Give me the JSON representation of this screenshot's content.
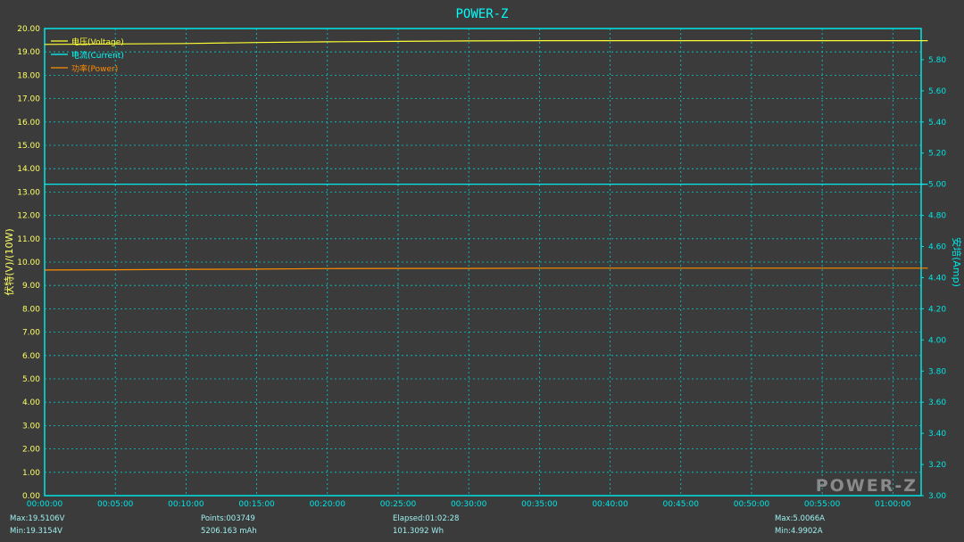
{
  "app_title": "POWER-Z",
  "watermark": "POWER-Z",
  "colors": {
    "background": "#3b3b3b",
    "plot_border": "#00e5e5",
    "grid": "#00d0d0",
    "title": "#00ffff",
    "left_axis_text": "#ffff66",
    "right_axis_text": "#00e5e5",
    "voltage": "#ffff33",
    "current": "#00ffff",
    "power": "#ff8c00",
    "watermark": "#8a8a8a"
  },
  "chart_data": {
    "type": "line",
    "title": "POWER-Z",
    "ylabel_left": "伏特(V)/(10W)",
    "ylabel_right": "安培(Amp)",
    "ylim_left": [
      0,
      20
    ],
    "ylim_right": [
      3.0,
      6.0
    ],
    "xlim_seconds": [
      0,
      3720
    ],
    "xticks": [
      "00:00:00",
      "00:05:00",
      "00:10:00",
      "00:15:00",
      "00:20:00",
      "00:25:00",
      "00:30:00",
      "00:35:00",
      "00:40:00",
      "00:45:00",
      "00:50:00",
      "00:55:00",
      "01:00:00"
    ],
    "yticks_left": [
      "0.00",
      "1.00",
      "2.00",
      "3.00",
      "4.00",
      "5.00",
      "6.00",
      "7.00",
      "8.00",
      "9.00",
      "10.00",
      "11.00",
      "12.00",
      "13.00",
      "14.00",
      "15.00",
      "16.00",
      "17.00",
      "18.00",
      "19.00",
      "20.00"
    ],
    "yticks_right": [
      "3.00",
      "3.20",
      "3.40",
      "3.60",
      "3.80",
      "4.00",
      "4.20",
      "4.40",
      "4.60",
      "4.80",
      "5.00",
      "5.20",
      "5.40",
      "5.60",
      "5.80"
    ],
    "grid": true,
    "legend_position": "top-left",
    "series": [
      {
        "name": "电压(Voltage)",
        "axis": "left",
        "color": "#ffff33",
        "x": [
          0,
          300,
          600,
          900,
          1200,
          1500,
          1800,
          2100,
          2400,
          2700,
          3000,
          3300,
          3600,
          3748
        ],
        "y": [
          19.32,
          19.34,
          19.36,
          19.4,
          19.43,
          19.45,
          19.47,
          19.48,
          19.48,
          19.48,
          19.48,
          19.48,
          19.48,
          19.48
        ]
      },
      {
        "name": "电流(Current)",
        "axis": "right",
        "color": "#00ffff",
        "x": [
          0,
          600,
          1200,
          1800,
          2400,
          3000,
          3600,
          3748
        ],
        "y": [
          5.0,
          5.0,
          5.0,
          5.0,
          5.0,
          5.0,
          5.0,
          5.0
        ]
      },
      {
        "name": "功率(Power)",
        "axis": "left",
        "color": "#ff8c00",
        "x": [
          0,
          300,
          600,
          900,
          1200,
          1500,
          1800,
          2100,
          2400,
          2700,
          3000,
          3300,
          3600,
          3748
        ],
        "y": [
          9.66,
          9.67,
          9.69,
          9.7,
          9.72,
          9.73,
          9.73,
          9.74,
          9.74,
          9.74,
          9.74,
          9.74,
          9.74,
          9.74
        ]
      }
    ]
  },
  "stats": {
    "max_voltage": "Max:19.5106V",
    "min_voltage": "Min:19.3154V",
    "points": "Points:003749",
    "capacity": "5206.163 mAh",
    "elapsed": "Elapsed:01:02:28",
    "energy": "101.3092 Wh",
    "max_current": "Max:5.0066A",
    "min_current": "Min:4.9902A"
  }
}
